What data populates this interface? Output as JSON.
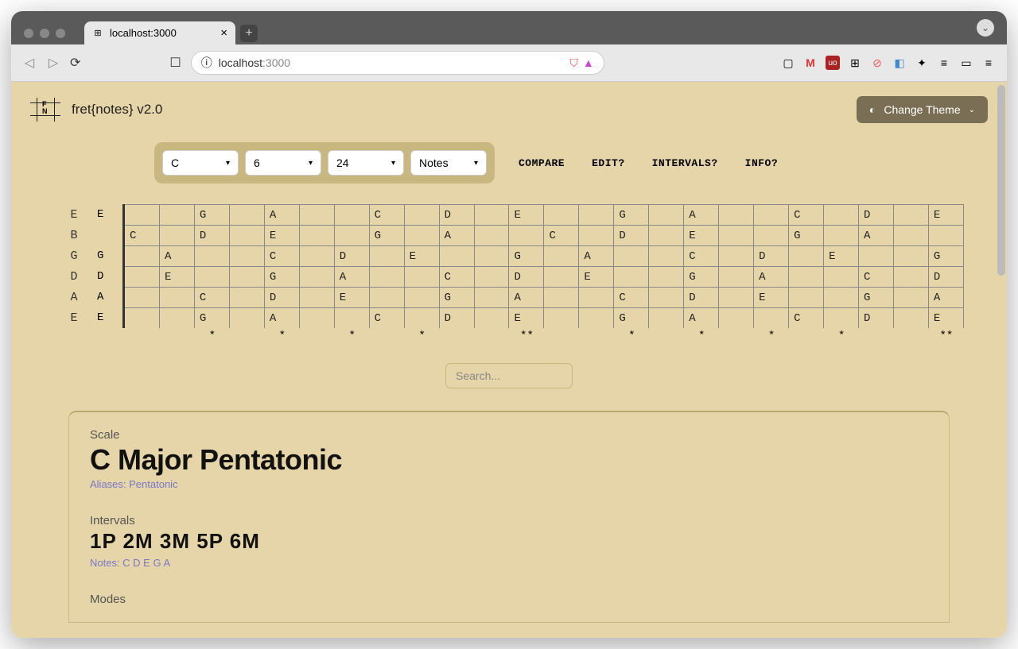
{
  "browser": {
    "tab_title": "localhost:3000",
    "url_host": "localhost",
    "url_path": ":3000"
  },
  "app": {
    "title": "fret{notes} v2.0",
    "theme_button": "Change Theme"
  },
  "selectors": {
    "root": "C",
    "strings": "6",
    "frets": "24",
    "display": "Notes"
  },
  "actions": {
    "compare": "COMPARE",
    "edit": "EDIT?",
    "intervals": "INTERVALS?",
    "info": "INFO?"
  },
  "fretboard": {
    "open_labels": [
      "E",
      "B",
      "G",
      "D",
      "A",
      "E"
    ],
    "rows": [
      {
        "open": "E",
        "frets": [
          "",
          "",
          "G",
          "",
          "A",
          "",
          "",
          "C",
          "",
          "D",
          "",
          "E",
          "",
          "",
          "G",
          "",
          "A",
          "",
          "",
          "C",
          "",
          "D",
          "",
          "E"
        ]
      },
      {
        "open": "",
        "frets": [
          "C",
          "",
          "D",
          "",
          "E",
          "",
          "",
          "G",
          "",
          "A",
          "",
          "",
          "C",
          "",
          "D",
          "",
          "E",
          "",
          "",
          "G",
          "",
          "A",
          "",
          ""
        ]
      },
      {
        "open": "G",
        "frets": [
          "",
          "A",
          "",
          "",
          "C",
          "",
          "D",
          "",
          "E",
          "",
          "",
          "G",
          "",
          "A",
          "",
          "",
          "C",
          "",
          "D",
          "",
          "E",
          "",
          "",
          "G"
        ]
      },
      {
        "open": "D",
        "frets": [
          "",
          "E",
          "",
          "",
          "G",
          "",
          "A",
          "",
          "",
          "C",
          "",
          "D",
          "",
          "E",
          "",
          "",
          "G",
          "",
          "A",
          "",
          "",
          "C",
          "",
          "D"
        ]
      },
      {
        "open": "A",
        "frets": [
          "",
          "",
          "C",
          "",
          "D",
          "",
          "E",
          "",
          "",
          "G",
          "",
          "A",
          "",
          "",
          "C",
          "",
          "D",
          "",
          "E",
          "",
          "",
          "G",
          "",
          "A"
        ]
      },
      {
        "open": "E",
        "frets": [
          "",
          "",
          "G",
          "",
          "A",
          "",
          "",
          "C",
          "",
          "D",
          "",
          "E",
          "",
          "",
          "G",
          "",
          "A",
          "",
          "",
          "C",
          "",
          "D",
          "",
          "E"
        ]
      }
    ],
    "markers": [
      "",
      "",
      "*",
      "",
      "*",
      "",
      "*",
      "",
      "*",
      "",
      "",
      "**",
      "",
      "",
      "*",
      "",
      "*",
      "",
      "*",
      "",
      "*",
      "",
      "",
      "**"
    ]
  },
  "search": {
    "placeholder": "Search..."
  },
  "card": {
    "type_label": "Scale",
    "title": "C Major Pentatonic",
    "aliases": "Aliases: Pentatonic",
    "intervals_label": "Intervals",
    "intervals": "1P  2M  3M  5P  6M",
    "notes_label": "Notes: C   D   E   G   A",
    "modes_label": "Modes"
  }
}
